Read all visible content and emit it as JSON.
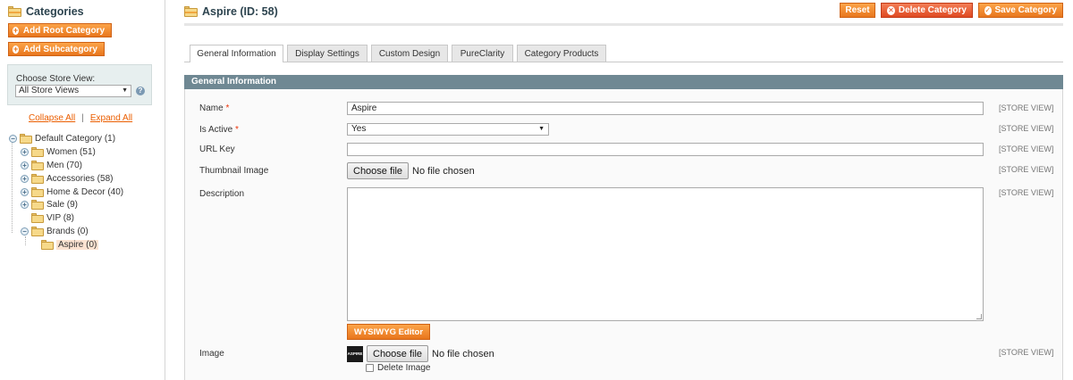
{
  "sidebar": {
    "title": "Categories",
    "add_root_label": "Add Root Category",
    "add_sub_label": "Add Subcategory",
    "store_view_label": "Choose Store View:",
    "store_view_value": "All Store Views",
    "collapse_label": "Collapse All",
    "links_separator": "|",
    "expand_label": "Expand All",
    "tree": [
      {
        "label": "Default Category (1)"
      },
      {
        "label": "Women (51)"
      },
      {
        "label": "Men (70)"
      },
      {
        "label": "Accessories (58)"
      },
      {
        "label": "Home & Decor (40)"
      },
      {
        "label": "Sale (9)"
      },
      {
        "label": "VIP (8)"
      },
      {
        "label": "Brands (0)"
      },
      {
        "label": "Aspire (0)"
      }
    ]
  },
  "header": {
    "title": "Aspire (ID: 58)",
    "reset_label": "Reset",
    "delete_label": "Delete Category",
    "save_label": "Save Category"
  },
  "tabs": [
    {
      "label": "General Information"
    },
    {
      "label": "Display Settings"
    },
    {
      "label": "Custom Design"
    },
    {
      "label": "PureClarity"
    },
    {
      "label": "Category Products"
    }
  ],
  "form": {
    "section_title": "General Information",
    "scope_label": "[STORE VIEW]",
    "required_mark": "*",
    "name_label": "Name",
    "name_value": "Aspire",
    "active_label": "Is Active",
    "active_value": "Yes",
    "urlkey_label": "URL Key",
    "urlkey_value": "",
    "thumbnail_label": "Thumbnail Image",
    "description_label": "Description",
    "wysiwyg_label": "WYSIWYG Editor",
    "image_label": "Image",
    "image_thumb_text": "ASPIRE",
    "choose_file_label": "Choose file",
    "no_file_label": "No file chosen",
    "delete_image_label": "Delete Image"
  },
  "colors": {
    "accent_orange": "#e8761d",
    "delete_red": "#df4a22",
    "section_header": "#6f8893",
    "link_orange": "#eb5e00"
  }
}
